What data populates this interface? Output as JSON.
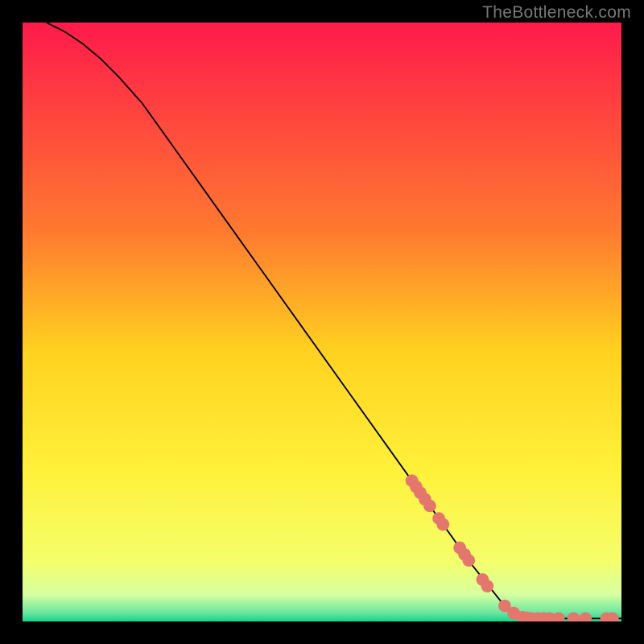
{
  "attribution": "TheBottleneck.com",
  "chart_data": {
    "type": "line",
    "title": "",
    "xlabel": "",
    "ylabel": "",
    "xlim": [
      0,
      100
    ],
    "ylim": [
      0,
      100
    ],
    "background_gradient": {
      "stops": [
        {
          "offset": 0.0,
          "color": "#ff1a4b"
        },
        {
          "offset": 0.35,
          "color": "#ff7a2f"
        },
        {
          "offset": 0.55,
          "color": "#ffd21f"
        },
        {
          "offset": 0.75,
          "color": "#fff13a"
        },
        {
          "offset": 0.9,
          "color": "#f4ff6a"
        },
        {
          "offset": 0.955,
          "color": "#d7ffa0"
        },
        {
          "offset": 0.985,
          "color": "#6be8a0"
        },
        {
          "offset": 1.0,
          "color": "#17d38a"
        }
      ]
    },
    "series": [
      {
        "name": "curve",
        "type": "line",
        "color": "#000000",
        "x": [
          4,
          7,
          10,
          13,
          16,
          20,
          25,
          30,
          35,
          40,
          45,
          50,
          55,
          60,
          65,
          70,
          75,
          80,
          83,
          86,
          100
        ],
        "y": [
          100,
          98.5,
          96.5,
          94,
          91,
          86.5,
          79.5,
          72.5,
          65.5,
          58.5,
          51.5,
          44.5,
          37.5,
          30.5,
          23.5,
          16.5,
          9.5,
          3.2,
          1.0,
          0.5,
          0.5
        ]
      },
      {
        "name": "highlight-points",
        "type": "scatter",
        "color": "#e4766e",
        "x": [
          65.0,
          65.7,
          66.4,
          67.2,
          68.0,
          69.5,
          70.2,
          73.0,
          73.8,
          74.5,
          76.8,
          77.6,
          80.5,
          82.0,
          83.5,
          84.2,
          85.0,
          86.0,
          87.0,
          88.0,
          89.5,
          92.0,
          94.0,
          97.5,
          98.5
        ],
        "y": [
          23.5,
          22.5,
          21.5,
          20.4,
          19.3,
          17.2,
          16.2,
          12.3,
          11.2,
          10.2,
          7.0,
          5.9,
          2.6,
          1.4,
          0.7,
          0.6,
          0.5,
          0.5,
          0.5,
          0.5,
          0.5,
          0.5,
          0.5,
          0.5,
          0.5
        ]
      }
    ]
  }
}
